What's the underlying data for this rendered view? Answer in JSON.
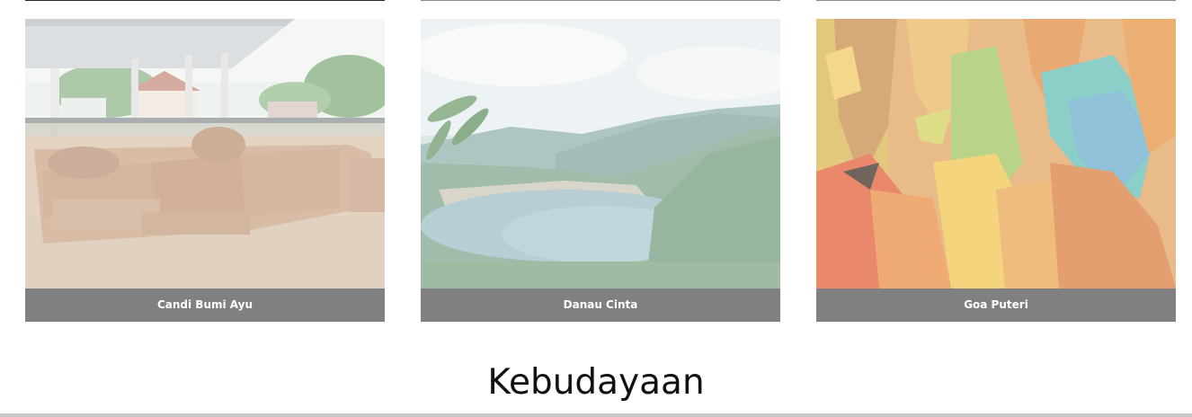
{
  "gallery": {
    "items": [
      {
        "caption": "Candi Bumi Ayu"
      },
      {
        "caption": "Danau Cinta"
      },
      {
        "caption": "Goa Puteri"
      }
    ]
  },
  "section": {
    "title": "Kebudayaan"
  },
  "colors": {
    "caption_bg": "#808080",
    "caption_text": "#ffffff",
    "title_text": "#111111"
  }
}
